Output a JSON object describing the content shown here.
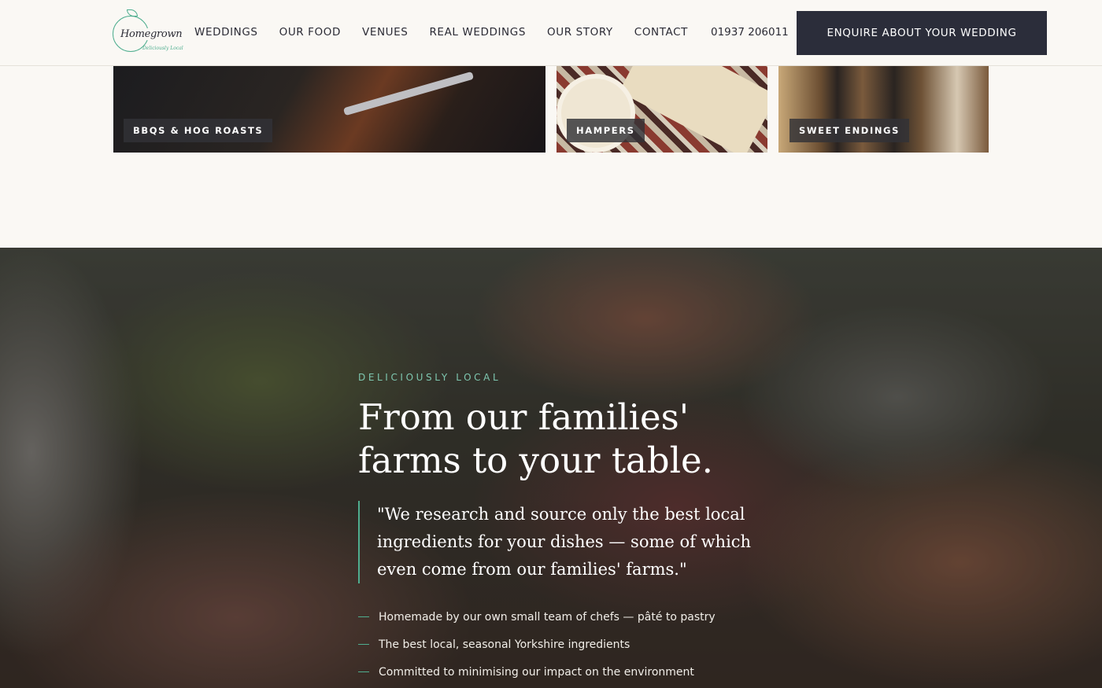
{
  "header": {
    "logo_text": "Homegrown",
    "logo_tagline": "Deliciously Local",
    "nav": [
      "WEDDINGS",
      "OUR FOOD",
      "VENUES",
      "REAL WEDDINGS",
      "OUR STORY",
      "CONTACT"
    ],
    "phone": "01937 206011",
    "cta_label": "ENQUIRE ABOUT YOUR WEDDING"
  },
  "tiles": [
    {
      "label": "BBQS & HOG ROASTS"
    },
    {
      "label": "HAMPERS"
    },
    {
      "label": "SWEET ENDINGS"
    }
  ],
  "hero": {
    "eyebrow": "DELICIOUSLY LOCAL",
    "heading": "From our families' farms to your table.",
    "quote": "\"We research and source only the best local ingredients for your dishes — some of which even come from our families' farms.\"",
    "bullets": [
      "Homemade by our own small team of chefs — pâté to pastry",
      "The best local, seasonal Yorkshire ingredients",
      "Committed to minimising our impact on the environment"
    ]
  },
  "colors": {
    "accent": "#4fae8f",
    "cta_background": "#2b2d3a",
    "page_background": "#faf8f4"
  }
}
